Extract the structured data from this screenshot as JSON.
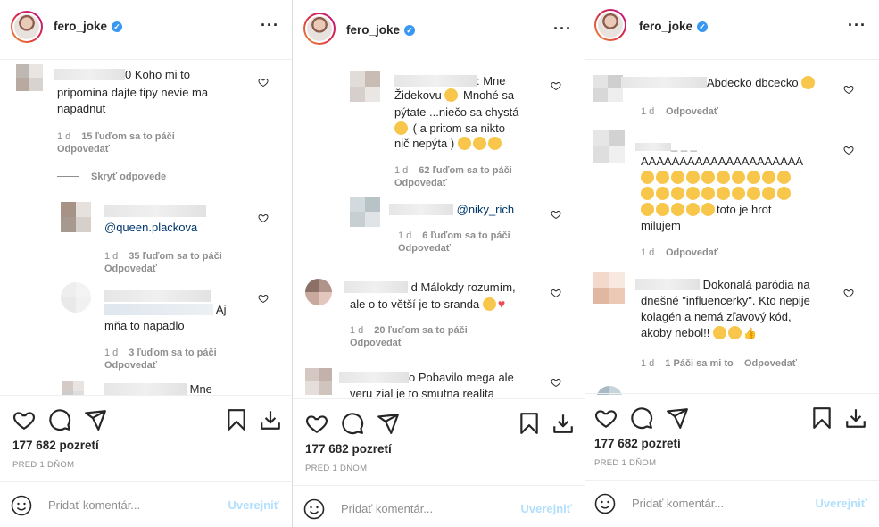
{
  "username": "fero_joke",
  "views": "177 682 pozretí",
  "time_ago": "PRED 1 DŇOM",
  "add_comment_placeholder": "Pridať komentár...",
  "post_label": "Uverejniť",
  "icons": [
    "heart-icon",
    "comment-icon",
    "share-icon",
    "bookmark-icon",
    "download-icon",
    "smile-icon",
    "verified-icon",
    "more-icon"
  ],
  "colors": {
    "verified": "#3897f0",
    "meta": "#8e8e8e",
    "post_disabled": "#b2dffc",
    "mention": "#00376b",
    "red_heart": "#ed4956"
  },
  "panels": [
    {
      "comments": [
        {
          "text_a": "0 Koho mi to",
          "text_b": "pripomina dajte tipy nevie ma",
          "text_c": "napadnut",
          "age": "1 d",
          "likes": "15 ľuďom sa to páči",
          "reply": "Odpovedať"
        },
        {
          "hide_replies": "Skryť odpovede"
        },
        {
          "mention": "@queen.plackova",
          "age": "1 d",
          "likes": "35 ľuďom sa to páči",
          "reply": "Odpovedať"
        },
        {
          "text_a": "Aj",
          "text_b": "mňa to napadlo",
          "age": "1 d",
          "likes": "3 ľuďom sa to páči",
          "reply": "Odpovedať"
        },
        {
          "text_a": "Mne"
        }
      ]
    },
    {
      "comments": [
        {
          "text_a": ": Mne",
          "text_b": "Židekovu",
          "text_b2": "Mnohé sa",
          "text_c": "pýtate ...niečo sa chystá",
          "text_d": "( a pritom sa nikto",
          "text_e": "nič nepýta )",
          "age": "1 d",
          "likes": "62 ľuďom sa to páči",
          "reply": "Odpovedať"
        },
        {
          "mention": "@niky_rich",
          "age": "1 d",
          "likes": "6 ľuďom sa to páči",
          "reply": "Odpovedať"
        },
        {
          "text_a": "d Málokdy rozumím,",
          "text_b": "ale o to větší je to sranda",
          "age": "1 d",
          "likes": "20 ľuďom sa to páči",
          "reply": "Odpovedať"
        },
        {
          "text_a": "o Pobavilo mega ale",
          "text_b": "veru zial je to smutna realita"
        }
      ]
    },
    {
      "comments": [
        {
          "text_a": "Abdecko dbcecko",
          "age": "1 d",
          "reply": "Odpovedať"
        },
        {
          "text_a": "_ _ _",
          "text_b": "AAAAAAAAAAAAAAAAAAAAA",
          "text_c": "toto je hrot",
          "text_d": "milujem",
          "age": "1 d",
          "reply": "Odpovedať"
        },
        {
          "text_a": "Dokonalá paródia na",
          "text_b": "dnešné \"influencerky\". Kto nepije",
          "text_c": "kolagén a nemá zľavový kód,",
          "text_d": "akoby nebol!!",
          "age": "1 d",
          "likes": "1 Páči sa mi to",
          "reply": "Odpovedať"
        }
      ]
    }
  ]
}
